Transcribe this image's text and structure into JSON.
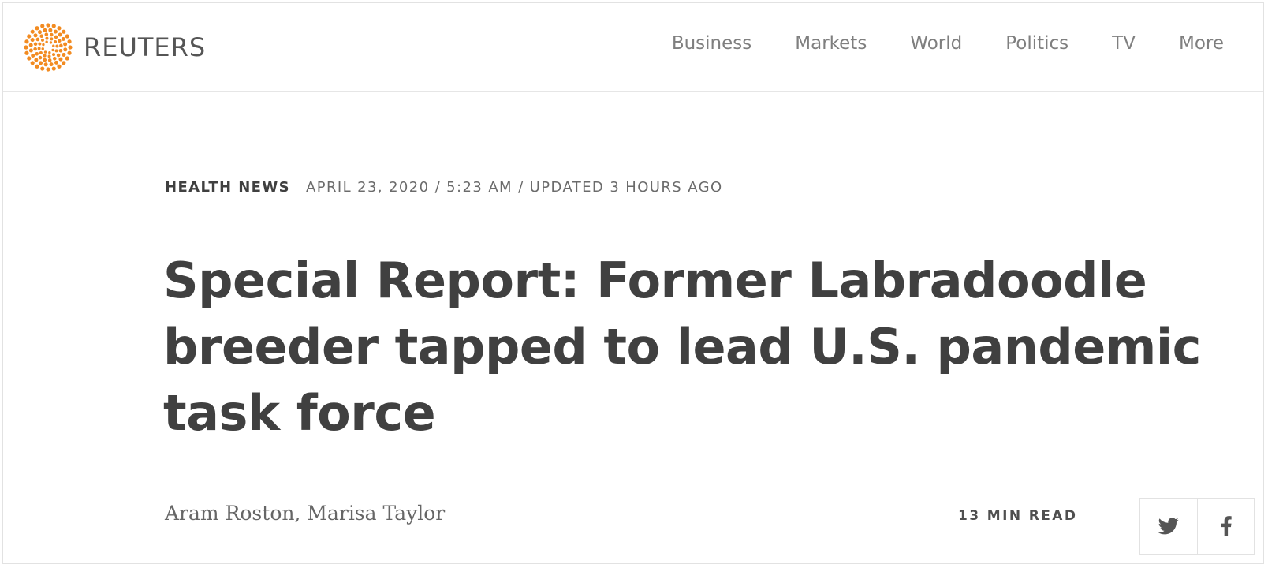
{
  "header": {
    "brand": "REUTERS",
    "brand_color": "#f28b21",
    "nav": [
      {
        "label": "Business"
      },
      {
        "label": "Markets"
      },
      {
        "label": "World"
      },
      {
        "label": "Politics"
      },
      {
        "label": "TV"
      },
      {
        "label": "More"
      }
    ]
  },
  "article": {
    "section": "HEALTH NEWS",
    "dateline": "APRIL 23, 2020 / 5:23 AM / UPDATED 3 HOURS AGO",
    "headline": "Special Report: Former Labradoodle breeder tapped to lead U.S. pandemic task force",
    "authors": "Aram Roston, Marisa Taylor",
    "read_time": "13 MIN READ"
  },
  "share": {
    "icons": [
      "twitter-icon",
      "facebook-icon"
    ]
  }
}
